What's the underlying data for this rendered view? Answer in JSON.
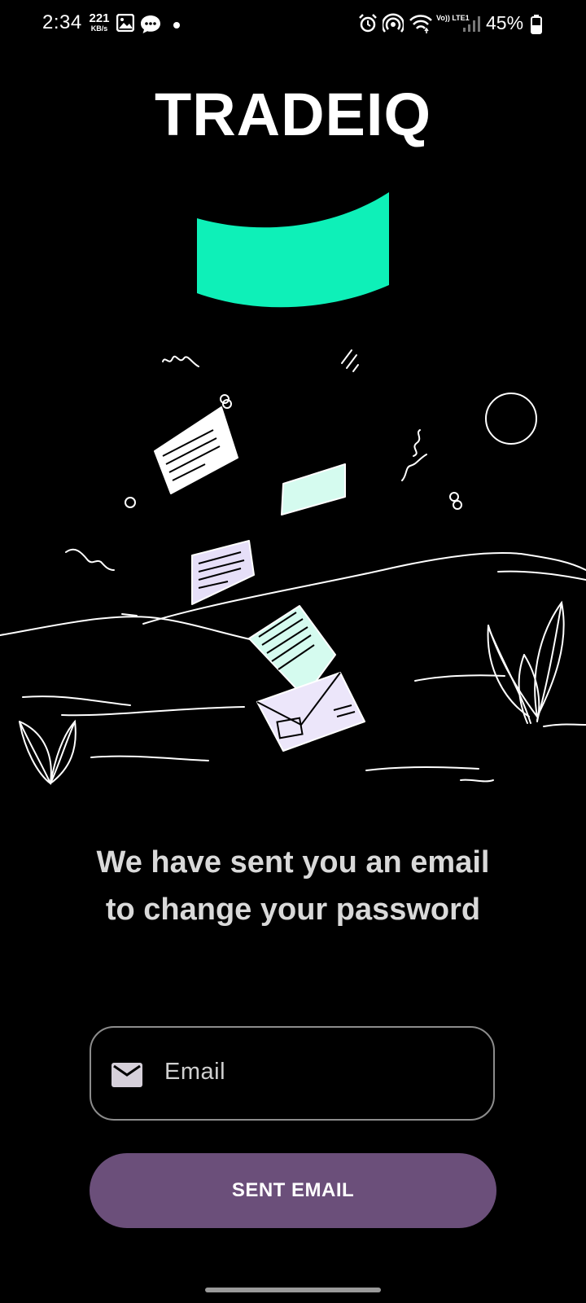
{
  "status_bar": {
    "time": "2:34",
    "net_speed_value": "221",
    "net_speed_unit": "KB/s",
    "volte_label": "Vo)) LTE1",
    "battery_percent": "45%",
    "icons": [
      "gallery-icon",
      "chat-icon",
      "alarm-icon",
      "hotspot-icon",
      "wifi-icon",
      "signal-icon",
      "battery-icon"
    ]
  },
  "header": {
    "title": "TRADEIQ"
  },
  "logo": {
    "color": "#0ef0b8"
  },
  "message": {
    "text": "We have sent you an email to change your password"
  },
  "form": {
    "email_placeholder": "Email",
    "email_value": "",
    "submit_label": "SENT EMAIL",
    "button_color": "#6b4f7a"
  }
}
